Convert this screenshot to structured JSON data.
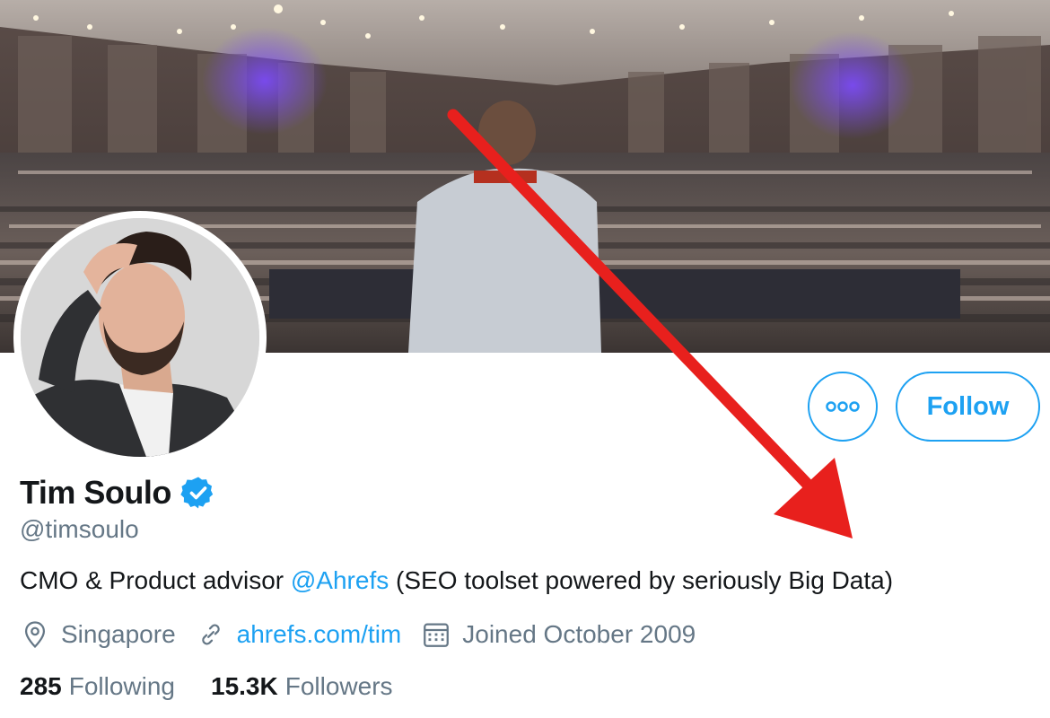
{
  "profile": {
    "name": "Tim Soulo",
    "handle": "@timsoulo",
    "bio_prefix": "CMO & Product advisor ",
    "bio_mention": "@Ahrefs",
    "bio_suffix": " (SEO toolset powered by seriously Big Data)",
    "location": "Singapore",
    "website": "ahrefs.com/tim",
    "joined": "Joined October 2009",
    "verified": true
  },
  "actions": {
    "more_icon": "more-dots-icon",
    "follow_label": "Follow"
  },
  "stats": {
    "following_count": "285",
    "following_label": "Following",
    "followers_count": "15.3K",
    "followers_label": "Followers"
  },
  "colors": {
    "accent": "#1da1f2",
    "secondary_text": "#657786",
    "primary_text": "#14171a",
    "annotation_arrow": "#e8201d"
  }
}
